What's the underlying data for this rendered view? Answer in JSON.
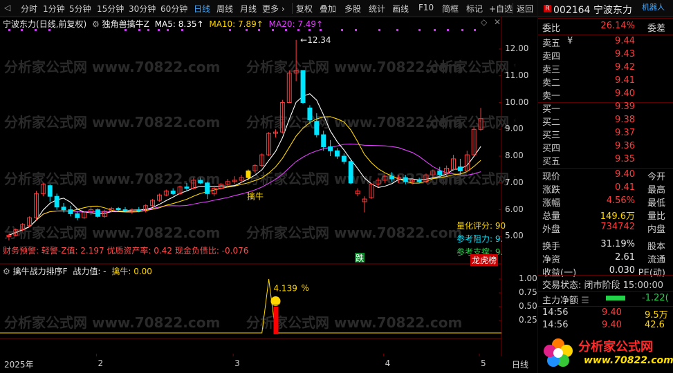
{
  "toolbar": {
    "items": [
      "分时",
      "1分钟",
      "5分钟",
      "15分钟",
      "30分钟",
      "60分钟",
      "日线",
      "周线",
      "月线",
      "更多 ›",
      "复权",
      "叠加",
      "多股",
      "统计",
      "画线",
      "F10",
      "简框",
      "标记",
      "+自选",
      "返回"
    ],
    "active_index": 6
  },
  "header": {
    "stock_name": "宁波东力",
    "period": "(日线,前复权)",
    "indicator": "独角兽擒牛Z",
    "ma5_label": "MA5: 8.35↑",
    "ma10_label": "MA10: 7.89↑",
    "ma20_label": "MA20: 7.49↑",
    "colors": {
      "ma5": "#ffffff",
      "ma10": "#ffd700",
      "ma20": "#e040fb"
    }
  },
  "main_chart": {
    "price_ticks": [
      "12.00",
      "11.00",
      "10.00",
      "9.00",
      "8.00",
      "7.00",
      "6.00",
      "5.00"
    ],
    "high_marker": "12.34",
    "signal_label": "擒牛",
    "drop_label": "跌",
    "info_line": "财务预警: 轻警-Z值: 2.197 优质资产率: 0.42 现金负债比: -0.076",
    "overlay_labels": [
      "量化评分: 90",
      "参考阻力: 9.",
      "参考支撑: 9."
    ],
    "list_badge": "龙虎榜",
    "candles": [
      [
        5.0,
        5.1,
        4.85,
        5.05
      ],
      [
        5.05,
        5.3,
        5.0,
        5.25
      ],
      [
        5.25,
        5.5,
        5.2,
        5.45
      ],
      [
        5.4,
        5.75,
        5.35,
        5.7
      ],
      [
        5.7,
        6.7,
        5.6,
        6.6
      ],
      [
        6.6,
        7.0,
        6.5,
        6.95
      ],
      [
        6.9,
        6.95,
        6.3,
        6.5
      ],
      [
        6.5,
        6.6,
        6.0,
        6.1
      ],
      [
        6.1,
        6.25,
        5.9,
        6.0
      ],
      [
        6.0,
        6.15,
        5.75,
        5.85
      ],
      [
        5.85,
        5.95,
        5.6,
        5.7
      ],
      [
        5.7,
        5.95,
        5.65,
        5.9
      ],
      [
        5.9,
        6.1,
        5.8,
        6.0
      ],
      [
        6.0,
        6.05,
        5.7,
        5.75
      ],
      [
        5.75,
        6.0,
        5.7,
        5.95
      ],
      [
        5.95,
        6.1,
        5.9,
        6.05
      ],
      [
        6.05,
        6.1,
        5.95,
        6.0
      ],
      [
        6.0,
        6.1,
        5.9,
        5.95
      ],
      [
        5.95,
        6.05,
        5.85,
        6.0
      ],
      [
        6.0,
        6.1,
        5.9,
        5.95
      ],
      [
        5.95,
        6.2,
        5.9,
        6.15
      ],
      [
        6.15,
        6.4,
        6.1,
        6.35
      ],
      [
        6.35,
        6.6,
        6.3,
        6.55
      ],
      [
        6.55,
        6.75,
        6.5,
        6.7
      ],
      [
        6.7,
        6.8,
        6.55,
        6.6
      ],
      [
        6.6,
        6.9,
        6.55,
        6.85
      ],
      [
        6.85,
        7.0,
        6.7,
        6.8
      ],
      [
        6.8,
        7.2,
        6.75,
        7.1
      ],
      [
        7.1,
        7.2,
        6.95,
        7.0
      ],
      [
        7.0,
        7.05,
        6.4,
        6.6
      ],
      [
        6.6,
        6.9,
        6.5,
        6.8
      ],
      [
        6.8,
        7.0,
        6.75,
        6.95
      ],
      [
        6.95,
        7.15,
        6.85,
        7.05
      ],
      [
        7.05,
        7.25,
        6.95,
        7.1
      ],
      [
        7.1,
        7.3,
        7.0,
        7.2
      ],
      [
        7.2,
        7.5,
        7.1,
        7.45
      ],
      [
        7.45,
        7.7,
        7.4,
        7.65
      ],
      [
        7.65,
        8.1,
        7.6,
        8.05
      ],
      [
        8.05,
        8.9,
        8.0,
        8.85
      ],
      [
        8.85,
        9.0,
        8.7,
        8.9
      ],
      [
        8.9,
        10.1,
        8.85,
        10.0
      ],
      [
        10.0,
        11.2,
        10.0,
        11.1
      ],
      [
        11.1,
        12.34,
        10.8,
        11.2
      ],
      [
        11.2,
        10.6,
        9.95,
        10.0
      ],
      [
        9.8,
        9.9,
        9.2,
        9.35
      ],
      [
        9.3,
        9.6,
        8.7,
        8.8
      ],
      [
        8.8,
        8.95,
        8.2,
        8.35
      ],
      [
        8.35,
        8.6,
        8.0,
        8.2
      ],
      [
        8.2,
        8.3,
        7.9,
        8.0
      ],
      [
        8.0,
        8.1,
        7.7,
        7.8
      ],
      [
        7.8,
        7.9,
        6.95,
        7.0
      ],
      [
        6.6,
        6.8,
        6.5,
        6.7
      ],
      [
        6.3,
        6.5,
        5.9,
        6.4
      ],
      [
        6.45,
        7.0,
        6.4,
        6.95
      ],
      [
        6.95,
        7.2,
        6.85,
        7.1
      ],
      [
        7.1,
        7.3,
        7.0,
        7.25
      ],
      [
        7.25,
        7.4,
        7.05,
        7.15
      ],
      [
        7.15,
        7.3,
        7.0,
        7.2
      ],
      [
        7.2,
        7.3,
        6.95,
        7.05
      ],
      [
        7.05,
        7.15,
        6.95,
        7.1
      ],
      [
        7.1,
        7.2,
        7.0,
        7.05
      ],
      [
        7.05,
        7.35,
        7.0,
        7.3
      ],
      [
        7.3,
        7.5,
        7.2,
        7.45
      ],
      [
        7.45,
        7.6,
        7.2,
        7.3
      ],
      [
        7.35,
        7.65,
        7.25,
        7.55
      ],
      [
        7.5,
        8.05,
        7.45,
        7.9
      ],
      [
        7.6,
        7.9,
        7.3,
        7.45
      ],
      [
        7.45,
        8.2,
        7.4,
        8.05
      ],
      [
        8.05,
        9.1,
        8.0,
        9.0
      ],
      [
        9.0,
        9.8,
        8.95,
        9.4
      ]
    ]
  },
  "sub_chart": {
    "title": "擒牛战力排序F",
    "power_label": "战力值: -",
    "niu_label": "擒牛: 0.00",
    "ticks": [
      "1.00",
      "0.75",
      "0.50",
      "0.25"
    ],
    "peak_value": "4.139",
    "percent": "%",
    "peak_index": 38
  },
  "x_axis": {
    "labels": [
      {
        "text": "2025年",
        "index": 0
      },
      {
        "text": "2",
        "index": 13
      },
      {
        "text": "3",
        "index": 33
      },
      {
        "text": "4",
        "index": 55
      },
      {
        "text": "5",
        "index": 69
      }
    ],
    "period": "日线"
  },
  "quote": {
    "code_badge": "R",
    "code": "002164",
    "name": "宁波东力",
    "robot": "机器人",
    "weibi_label": "委比",
    "weibi_value": "26.14%",
    "weicha_label": "委差",
    "asks": [
      {
        "label": "卖五",
        "value": "9.44",
        "flag": "¥"
      },
      {
        "label": "卖四",
        "value": "9.43"
      },
      {
        "label": "卖三",
        "value": "9.42"
      },
      {
        "label": "卖二",
        "value": "9.41"
      },
      {
        "label": "卖一",
        "value": "9.40"
      }
    ],
    "bids": [
      {
        "label": "买一",
        "value": "9.39"
      },
      {
        "label": "买二",
        "value": "9.38"
      },
      {
        "label": "买三",
        "value": "9.37"
      },
      {
        "label": "买四",
        "value": "9.36"
      },
      {
        "label": "买五",
        "value": "9.35"
      }
    ],
    "stats": [
      {
        "label": "现价",
        "value": "9.40",
        "color": "red",
        "label2": "今开"
      },
      {
        "label": "涨跌",
        "value": "0.41",
        "color": "red",
        "label2": "最高"
      },
      {
        "label": "涨幅",
        "value": "4.56%",
        "color": "red",
        "label2": "最低"
      },
      {
        "label": "总量",
        "value": "149.6万",
        "color": "yellow",
        "label2": "量比"
      },
      {
        "label": "外盘",
        "value": "734742",
        "color": "red",
        "label2": "内盘"
      },
      {
        "label": "换手",
        "value": "31.19%",
        "color": "white",
        "label2": "股本"
      },
      {
        "label": "净资",
        "value": "2.61",
        "color": "white",
        "label2": "流通"
      },
      {
        "label": "收益(一)",
        "value": "0.030",
        "color": "white",
        "label2": "PE(动)"
      }
    ],
    "trade_status": "交易状态: 闭市阶段 15:00:00",
    "main_net_label": "主力净额",
    "main_net_value": "-1.22(",
    "ticks": [
      {
        "time": "14:56",
        "price": "9.40",
        "vol": "9.5万"
      },
      {
        "time": "14:56",
        "price": "9.40",
        "vol": "42.6万"
      }
    ]
  },
  "logo": {
    "text": "分析家公式网",
    "url": "www.70822.com"
  },
  "watermark": "分析家公式网 www.70822.com"
}
